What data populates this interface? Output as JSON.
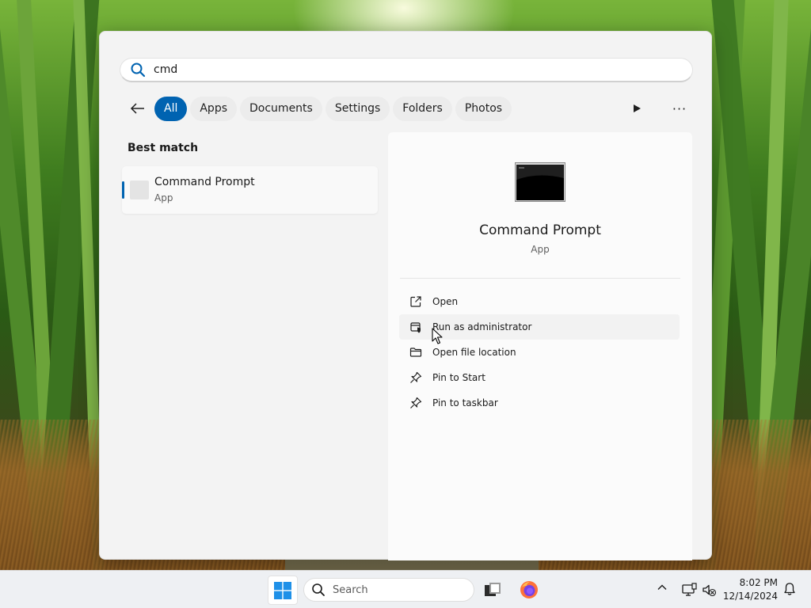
{
  "search": {
    "query": "cmd"
  },
  "filters": {
    "items": [
      {
        "label": "All",
        "active": true
      },
      {
        "label": "Apps"
      },
      {
        "label": "Documents"
      },
      {
        "label": "Settings"
      },
      {
        "label": "Folders"
      },
      {
        "label": "Photos"
      }
    ],
    "more_label": "···"
  },
  "best_match": {
    "heading": "Best match",
    "name": "Command Prompt",
    "type": "App"
  },
  "detail": {
    "name": "Command Prompt",
    "type": "App",
    "actions": [
      {
        "label": "Open",
        "icon": "open-external-icon"
      },
      {
        "label": "Run as administrator",
        "icon": "shield-admin-icon"
      },
      {
        "label": "Open file location",
        "icon": "folder-icon"
      },
      {
        "label": "Pin to Start",
        "icon": "pin-icon"
      },
      {
        "label": "Pin to taskbar",
        "icon": "pin-icon"
      }
    ]
  },
  "taskbar": {
    "search_placeholder": "Search",
    "time": "8:02 PM",
    "date": "12/14/2024"
  },
  "colors": {
    "accent": "#0063b1",
    "flyout_bg": "#f3f3f3",
    "taskbar_bg": "#eef0f3"
  }
}
